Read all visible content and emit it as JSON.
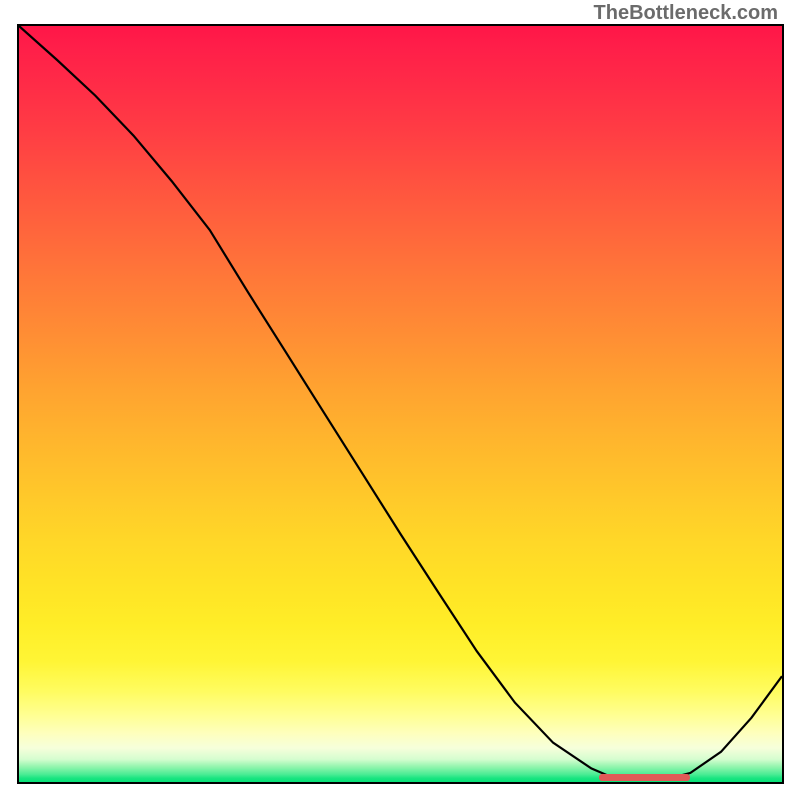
{
  "watermark": "TheBottleneck.com",
  "chart_data": {
    "type": "line",
    "title": "",
    "xlabel": "",
    "ylabel": "",
    "xlim": [
      0,
      100
    ],
    "ylim": [
      0,
      100
    ],
    "series": [
      {
        "name": "curve",
        "x": [
          0,
          5,
          10,
          15,
          20,
          25,
          30,
          35,
          40,
          45,
          50,
          55,
          60,
          65,
          70,
          75,
          78,
          82,
          85,
          88,
          92,
          96,
          100
        ],
        "y": [
          100,
          95.5,
          90.8,
          85.5,
          79.5,
          73.0,
          64.8,
          56.8,
          48.8,
          40.8,
          32.8,
          25.0,
          17.3,
          10.5,
          5.2,
          1.8,
          0.5,
          0.3,
          0.4,
          1.2,
          4.0,
          8.5,
          14.0
        ]
      }
    ],
    "annotations": [
      {
        "name": "optimal-range",
        "x_start": 76,
        "x_end": 88,
        "y": 0.6
      }
    ],
    "grid": false,
    "legend": false
  }
}
